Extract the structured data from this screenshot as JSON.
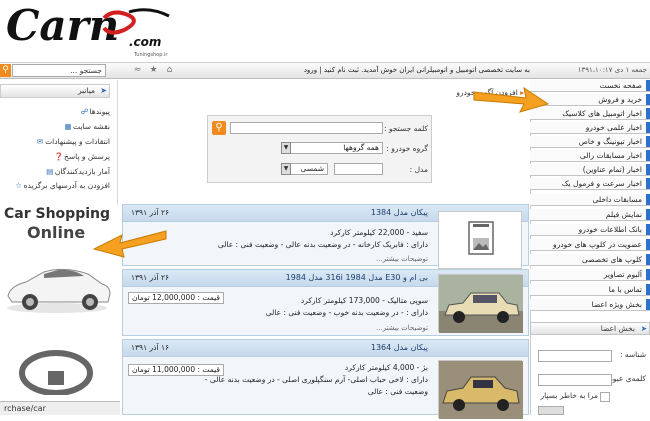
{
  "header": {
    "logo_text": "Carn",
    "logo_sub": ".com",
    "logo_tagline": "Tuningshop.ir"
  },
  "topbar": {
    "search_placeholder": "جستجو ...",
    "welcome": "به سایت تخصصی اتومبیل و اتومبیلرانی ایران خوش آمدید. ثبت نام کنید | ورود",
    "date": "جمعه ۱ دی ۱۳۹۱،۱۰:۱۷"
  },
  "left": {
    "head": "میانبر",
    "links": [
      {
        "label": "پیوندها",
        "icon": "link-icon"
      },
      {
        "label": "نقشه سایت",
        "icon": "sitemap-icon"
      },
      {
        "label": "انتقادات و پیشنهادات",
        "icon": "feedback-icon"
      },
      {
        "label": "پرسش و پاسخ",
        "icon": "question-icon"
      },
      {
        "label": "آمار بازدیدکنندگان",
        "icon": "chart-icon"
      },
      {
        "label": "افزودن به آدرسهای برگزیده",
        "icon": "star-icon"
      }
    ],
    "ad_title_1": "Car Shopping",
    "ad_title_2": "Online",
    "ad_url": "rchase/car"
  },
  "breadcrumb": "افزودن آگهی خودرو",
  "search_form": {
    "keyword_label": "کلمه جستجو :",
    "group_label": "گروه خودرو :",
    "group_value": "همه گروهها",
    "model_label": "مدل :",
    "model_value": "شمسی"
  },
  "listings": [
    {
      "title": "پیکان مدل 1384",
      "date": "۲۶ آذر ۱۳۹۱",
      "line1": "سفید - 22,000 کیلومتر کارکرد",
      "line2": "دارای : فابریک کارخانه - در وضعیت بدنه عالی - وضعیت فنی : عالی",
      "price": "",
      "more": "توضیحات بیشتر..."
    },
    {
      "title": "بی ام و E30 مدل 1984 316i مدل 1984",
      "date": "۲۶ آذر ۱۳۹۱",
      "line1": "سوپی متالیک - 173,000 کیلومتر کارکرد",
      "line2": "دارای : - در وضعیت بدنه خوب - وضعیت فنی : عالی",
      "price": "قیمت : 12,000,000 تومان",
      "more": "توضیحات بیشتر..."
    },
    {
      "title": "پیکان مدل 1364",
      "date": "۱۶ آذر ۱۳۹۱",
      "line1": "بژ - 4,000 کیلومتر کارکرد",
      "line2": "دارای : لاخی حباب اصلی- آرم سنگپلوری اصلی - در وضعیت بدنه عالی -",
      "line3": "وضعیت فنی : عالی",
      "price": "قیمت : 11,000,000 تومان",
      "more": ""
    }
  ],
  "menu": [
    "صفحه نخست",
    "خرید و فروش",
    "اخبار اتومبیل های کلاسیک",
    "اخبار علمی خودرو",
    "اخبار تیونینگ و خاص",
    "اخبار مسابقات رالی",
    "اخبار (تمام عناوین)",
    "اخبار سرعت و فرمول یک",
    "مسابقات داخلی",
    "نمایش فیلم",
    "بانک اطلاعات خودرو",
    "عضویت در کلوپ های خودرو",
    "کلوپ های تخصصی",
    "آلبوم تصاویر",
    "تماس با ما",
    "بخش ویژه اعضا"
  ],
  "login": {
    "head": "بخش اعضا",
    "user_label": "شناسه :",
    "pass_label": "کلمه‌ی عبور :",
    "remember_label": "مرا به خاطر بسپار"
  },
  "colors": {
    "accent_orange": "#f08a1c",
    "menu_blue": "#2c72c9",
    "listing_head": "#c6d9ec"
  }
}
